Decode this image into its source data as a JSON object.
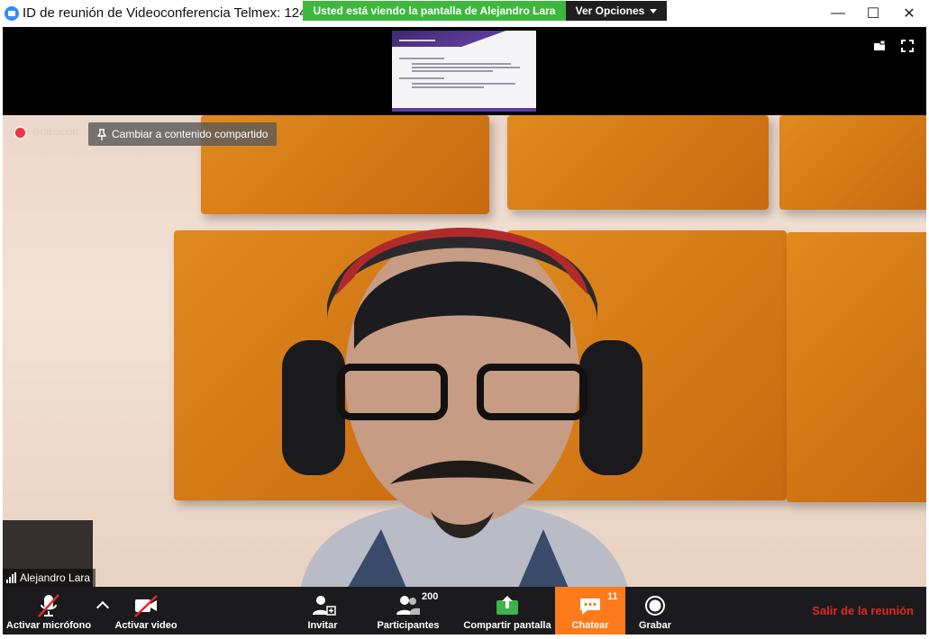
{
  "window": {
    "title": "ID de reunión de Videoconferencia Telmex: 124",
    "minimize_glyph": "—",
    "maximize_glyph": "☐",
    "close_glyph": "✕"
  },
  "banner": {
    "text": "Usted está viendo la pantalla de Alejandro Lara",
    "options_label": "Ver Opciones"
  },
  "overlay": {
    "recording_label": "Grabación",
    "switch_button_label": "Cambiar a contenido compartido",
    "participant_name": "Alejandro Lara"
  },
  "toolbar": {
    "mic_label": "Activar micrófono",
    "video_label": "Activar video",
    "invite_label": "Invitar",
    "participants_label": "Participantes",
    "participants_count": "200",
    "share_label": "Compartir pantalla",
    "chat_label": "Chatear",
    "chat_count": "11",
    "record_label": "Grabar",
    "leave_label": "Salir de la reunión"
  },
  "colors": {
    "banner_green": "#3db83d",
    "chat_active": "#ff7a1a",
    "leave_red": "#e02828",
    "zoom_blue": "#2d8cff"
  },
  "icons": [
    "zoom-logo-icon",
    "caret-down-icon",
    "pin-icon",
    "mic-off-icon",
    "video-off-icon",
    "invite-icon",
    "participants-icon",
    "share-screen-icon",
    "chat-icon",
    "record-icon",
    "signal-icon",
    "view-mode-icon",
    "fullscreen-icon"
  ]
}
